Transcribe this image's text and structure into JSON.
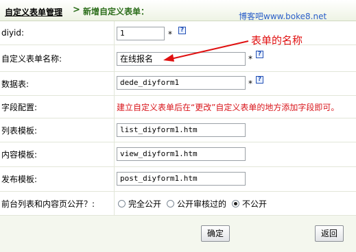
{
  "breadcrumb": {
    "home": "自定义表单管理",
    "separator": ">",
    "current": "新增自定义表单："
  },
  "watermark": "博客吧www.boke8.net",
  "annotation": "表单的名称",
  "form": {
    "diyid": {
      "label": "diyid:",
      "value": "1",
      "star": "*",
      "help": "?"
    },
    "name": {
      "label": "自定义表单名称:",
      "value": "在线报名",
      "star": "*",
      "help": "?"
    },
    "table": {
      "label": "数据表:",
      "value": "dede_diyform1",
      "star": "*",
      "help": "?"
    },
    "fields": {
      "label": "字段配置:",
      "note": "建立自定义表单后在“更改”自定义表单的地方添加字段即可。"
    },
    "list_tpl": {
      "label": "列表模板:",
      "value": "list_diyform1.htm"
    },
    "view_tpl": {
      "label": "内容模板:",
      "value": "view_diyform1.htm"
    },
    "post_tpl": {
      "label": "发布模板:",
      "value": "post_diyform1.htm"
    },
    "public": {
      "label": "前台列表和内容页公开？:",
      "options": [
        "完全公开",
        "公开审核过的",
        "不公开"
      ],
      "selected": "不公开"
    }
  },
  "buttons": {
    "ok": "确定",
    "back": "返回"
  },
  "colors": {
    "accent_green": "#2b6d1a",
    "note_red": "#d9151b",
    "annotation_red": "#e01010",
    "watermark_blue": "#2b5fc9"
  }
}
